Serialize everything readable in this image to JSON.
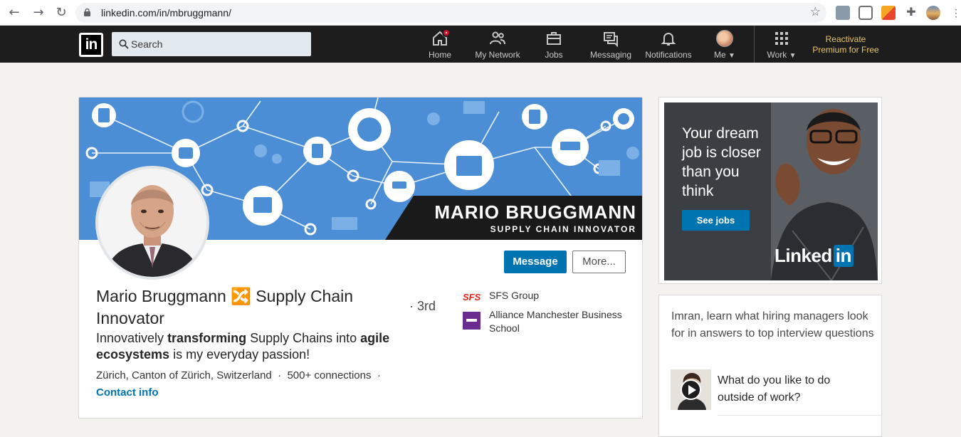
{
  "browser": {
    "url": "linkedin.com/in/mbruggmann/"
  },
  "nav": {
    "search_placeholder": "Search",
    "items": [
      {
        "label": "Home",
        "icon": "home-icon"
      },
      {
        "label": "My Network",
        "icon": "network-icon"
      },
      {
        "label": "Jobs",
        "icon": "briefcase-icon"
      },
      {
        "label": "Messaging",
        "icon": "messaging-icon"
      },
      {
        "label": "Notifications",
        "icon": "bell-icon"
      },
      {
        "label": "Me",
        "icon": "avatar"
      },
      {
        "label": "Work",
        "icon": "grid-icon"
      }
    ],
    "premium_line1": "Reactivate",
    "premium_line2": "Premium for Free",
    "colors": {
      "bar": "#1d1d1d",
      "premium": "#e7c66e",
      "badge": "#cb112d"
    }
  },
  "profile": {
    "banner_name": "MARIO BRUGGMANN",
    "banner_subtitle": "SUPPLY CHAIN INNOVATOR",
    "message_label": "Message",
    "more_label": "More...",
    "name_line1": "Mario Bruggmann 🔀 Supply Chain",
    "name_line2": "Innovator",
    "degree": "· 3rd",
    "headline_parts": {
      "p1": "Innovatively ",
      "b1": "transforming",
      "p2": " Supply Chains into ",
      "b2": "agile",
      "b3": "ecosystems",
      "p3": " is my everyday passion!"
    },
    "location": "Zürich, Canton of Zürich, Switzerland",
    "connections": "500+ connections",
    "contact_info": "Contact info",
    "experience": [
      {
        "name": "SFS Group",
        "logo_text": "SFS"
      },
      {
        "name_line1": "Alliance Manchester Business",
        "name_line2": "School"
      }
    ],
    "accent": "#0073b1"
  },
  "ad": {
    "headline_lines": [
      "Your dream",
      "job is closer",
      "than you",
      "think"
    ],
    "button": "See jobs",
    "brand": "Linked",
    "brand_in": "in"
  },
  "tip": {
    "text": "Imran, learn what hiring managers look for in answers to top interview questions",
    "question": "What do you like to do outside of work?"
  }
}
